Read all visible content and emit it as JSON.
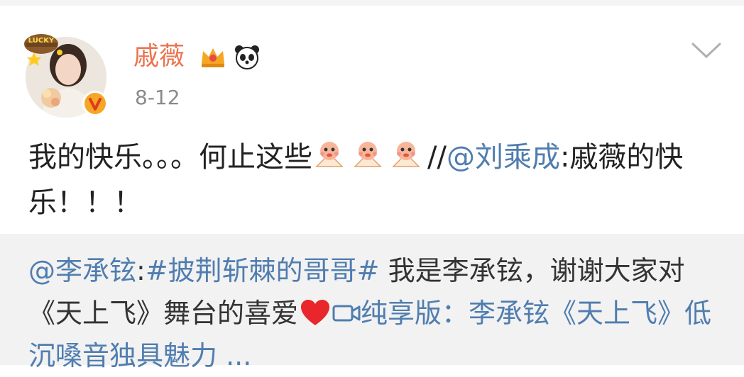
{
  "post": {
    "username": "戚薇",
    "time": "8-12",
    "avatar_badge": "LUCKY",
    "badges": [
      "crown-vip-icon",
      "panda-icon"
    ],
    "text": {
      "part1": "我的快乐。。。何止这些",
      "sep": "//",
      "mention": "@刘乘成",
      "part2": ":戚薇的快乐！！！"
    },
    "emoji_name": "fan-dance-emoji"
  },
  "repost": {
    "mention": "@李承铉",
    "colon": ":",
    "hashtag": "#披荆斩棘的哥哥#",
    "text1": " 我是李承铉，谢谢大家对《天上飞》舞台的喜爱",
    "link_text": "纯享版：李承铉《天上飞》低沉嗓音独具魅力",
    "ellipsis": " ..."
  },
  "colors": {
    "username": "#eb7350",
    "link": "#507daf",
    "repost_bg": "#f2f2f2"
  }
}
